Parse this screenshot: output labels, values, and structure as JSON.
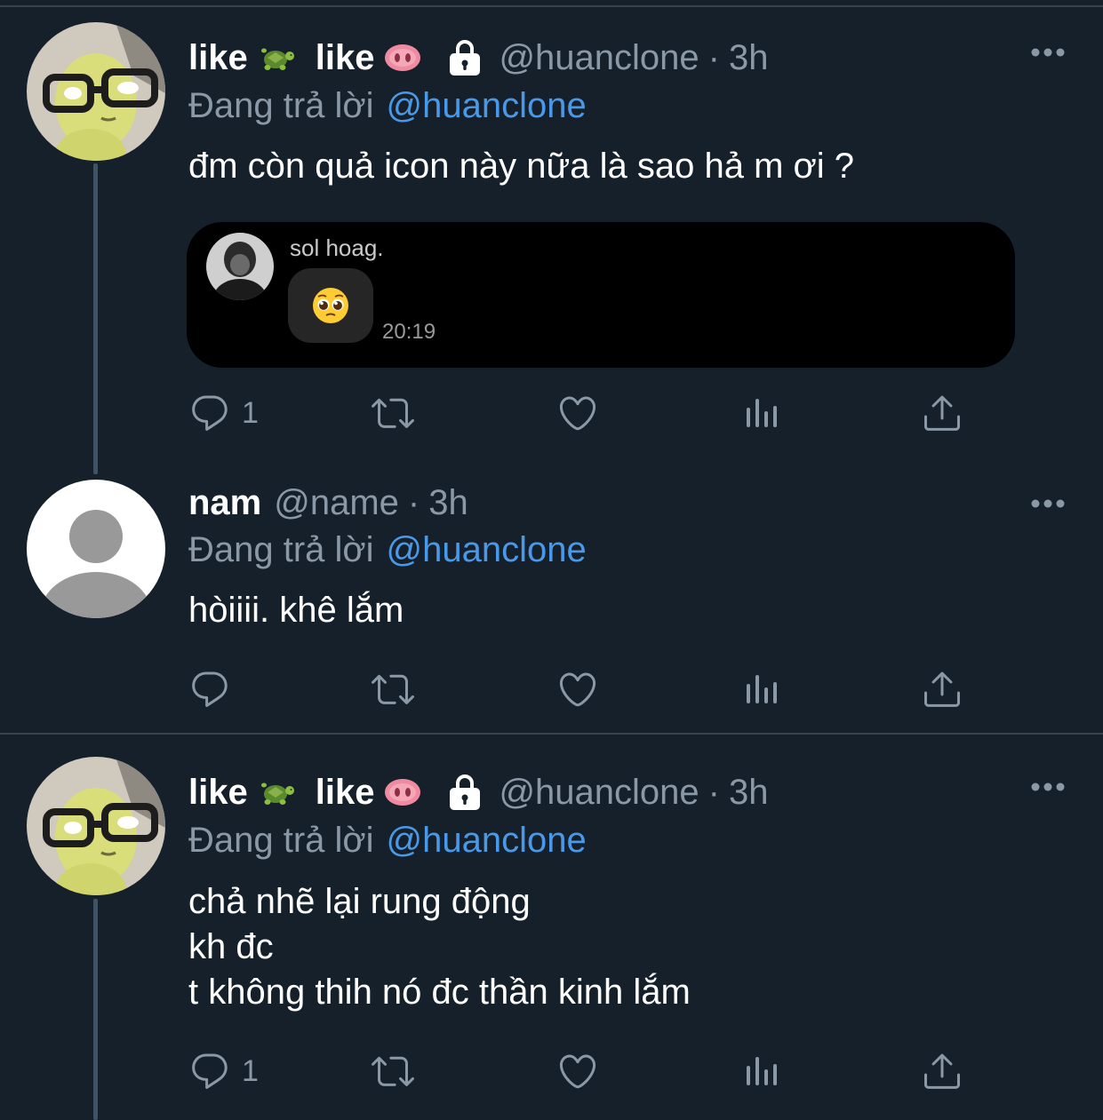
{
  "tweets": [
    {
      "display_name_1": "like",
      "display_name_2": "like",
      "name_emojis": [
        "turtle-emoji",
        "pig-nose-emoji"
      ],
      "locked": true,
      "handle": "@huanclone",
      "separator": "·",
      "time": "3h",
      "reply_prefix": "Đang trả lời",
      "reply_to": "@huanclone",
      "text_lines": [
        "đm còn quả icon này nữa là sao hả m ơi ?"
      ],
      "reply_count": "1",
      "media": {
        "sender_name": "sol hoag.",
        "message_emoji": "pleading-face-emoji",
        "time": "20:19"
      }
    },
    {
      "display_name": "nam",
      "handle": "@name",
      "separator": "·",
      "time": "3h",
      "reply_prefix": "Đang trả lời",
      "reply_to": "@huanclone",
      "text_lines": [
        "hòiiii. khê lắm"
      ],
      "reply_count": ""
    },
    {
      "display_name_1": "like",
      "display_name_2": "like",
      "name_emojis": [
        "turtle-emoji",
        "pig-nose-emoji"
      ],
      "locked": true,
      "handle": "@huanclone",
      "separator": "·",
      "time": "3h",
      "reply_prefix": "Đang trả lời",
      "reply_to": "@huanclone",
      "text_lines": [
        "chả nhẽ lại rung động",
        "kh đc",
        "t không thih nó đc thần kinh lắm"
      ],
      "reply_count": "1"
    }
  ],
  "colors": {
    "background": "#15202b",
    "secondary_text": "#8b98a5",
    "mention": "#4a99e9",
    "divider": "#38444d"
  }
}
